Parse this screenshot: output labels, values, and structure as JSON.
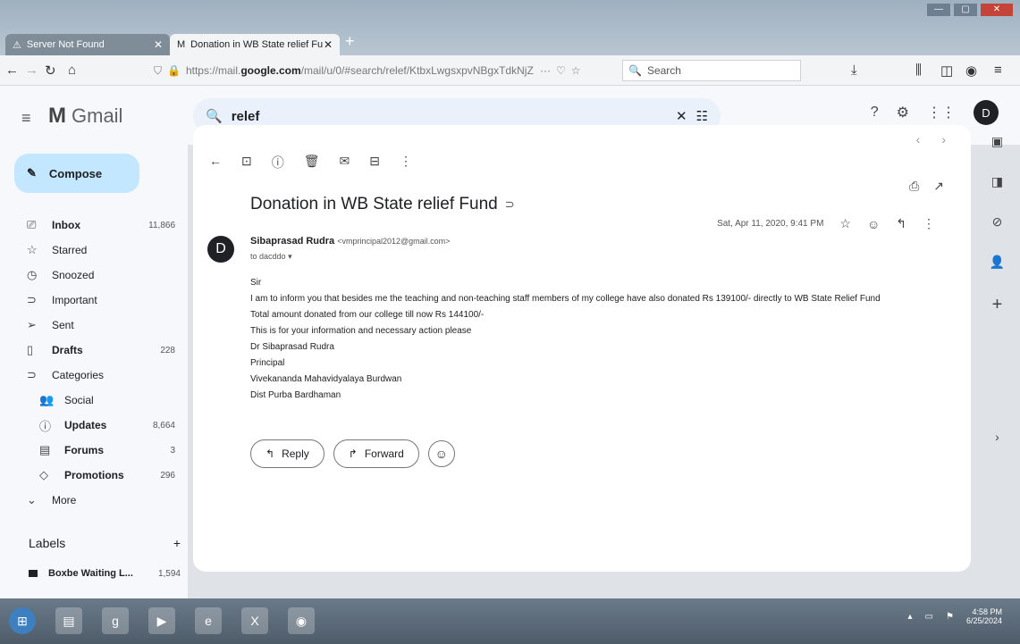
{
  "browser": {
    "tabs": [
      {
        "label": "Server Not Found",
        "icon": "warning-icon",
        "active": false
      },
      {
        "label": "Donation in WB State relief Fu",
        "icon": "gmail-icon",
        "active": true
      }
    ],
    "new_tab": "+",
    "url_prefix": "https://mail.",
    "url_domain": "google.com",
    "url_path": "/mail/u/0/#search/relef/KtbxLwgsxpvNBgxTdkNjZ",
    "url_more": "···",
    "search_placeholder": "Search"
  },
  "gmail": {
    "app_name": "Gmail",
    "search_query": "relef",
    "compose_label": "Compose",
    "nav": [
      {
        "label": "Inbox",
        "count": "11,866",
        "icon": "inbox-icon",
        "bold": true
      },
      {
        "label": "Starred",
        "count": "",
        "icon": "star-icon",
        "bold": false
      },
      {
        "label": "Snoozed",
        "count": "",
        "icon": "clock-icon",
        "bold": false
      },
      {
        "label": "Important",
        "count": "",
        "icon": "important-icon",
        "bold": false
      },
      {
        "label": "Sent",
        "count": "",
        "icon": "send-icon",
        "bold": false
      },
      {
        "label": "Drafts",
        "count": "228",
        "icon": "draft-icon",
        "bold": true
      },
      {
        "label": "Categories",
        "count": "",
        "icon": "label-icon",
        "bold": false
      },
      {
        "label": "Social",
        "count": "",
        "icon": "people-icon",
        "bold": false
      },
      {
        "label": "Updates",
        "count": "8,664",
        "icon": "info-icon",
        "bold": true
      },
      {
        "label": "Forums",
        "count": "3",
        "icon": "forum-icon",
        "bold": true
      },
      {
        "label": "Promotions",
        "count": "296",
        "icon": "tag-icon",
        "bold": true
      },
      {
        "label": "More",
        "count": "",
        "icon": "chevron-down-icon",
        "bold": false
      }
    ],
    "labels_heading": "Labels",
    "labels_add": "+",
    "labels": [
      {
        "label": "Boxbe Waiting L...",
        "count": "1,594"
      }
    ]
  },
  "email": {
    "subject": "Donation in WB State relief Fund",
    "sender_initial": "D",
    "sender_name": "Sibaprasad Rudra",
    "sender_email": "<vmprincipal2012@gmail.com>",
    "recipient": "to dacddo",
    "date": "Sat, Apr 11, 2020, 9:41 PM",
    "body_lines": [
      "Sir",
      "I am to inform you that besides me the teaching and non-teaching staff members of my college  have also donated Rs  139100/- directly to WB State Relief Fund",
      "Total amount donated from our college till now Rs 144100/-",
      "This is for your information and necessary action please",
      "Dr  Sibaprasad Rudra",
      "Principal",
      "Vivekananda Mahavidyalaya Burdwan",
      "Dist  Purba Bardhaman"
    ],
    "reply_label": "Reply",
    "forward_label": "Forward"
  },
  "taskbar": {
    "time": "4:58 PM",
    "date": "6/25/2024"
  },
  "colors": {
    "compose_bg": "#c2e7ff",
    "search_bg": "#eaf1fb",
    "sidebar_bg": "#f6f8fc"
  }
}
